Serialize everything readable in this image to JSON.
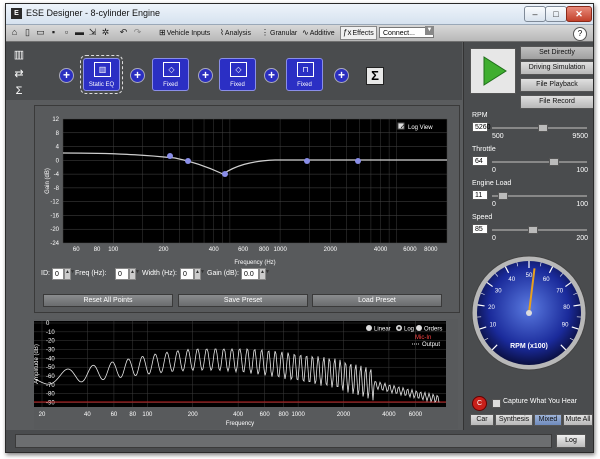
{
  "window": {
    "title": "ESE Designer - 8-cylinder Engine",
    "minimize": "–",
    "maximize": "□",
    "close": "✕"
  },
  "toolbar": {
    "items": [
      {
        "label": "Vehicle Inputs",
        "icon": "vehicle-inputs-icon"
      },
      {
        "label": "Analysis",
        "icon": "analysis-icon"
      },
      {
        "label": "Granular",
        "icon": "granular-icon"
      },
      {
        "label": "Additive",
        "icon": "additive-icon"
      },
      {
        "label": "Effects",
        "icon": "effects-icon",
        "active": true
      }
    ],
    "connect_label": "Connect...",
    "help": "?"
  },
  "chain": {
    "effects": [
      {
        "label": "Static EQ",
        "icon": "equalizer-icon"
      },
      {
        "label": "Fixed",
        "icon": "diamond-filter-icon"
      },
      {
        "label": "Fixed",
        "icon": "diamond-filter-icon"
      },
      {
        "label": "Fixed",
        "icon": "bandpass-filter-icon"
      }
    ],
    "sum_symbol": "Σ",
    "plus_symbol": "+"
  },
  "eq": {
    "log_view_label": "Log View",
    "ylabel": "Gain (dB)",
    "xlabel": "Frequency (Hz)",
    "y_ticks": [
      "12",
      "8",
      "4",
      "0",
      "-4",
      "-8",
      "-12",
      "-16",
      "-20",
      "-24"
    ],
    "x_ticks": [
      "60",
      "80",
      "100",
      "200",
      "400",
      "600",
      "800",
      "1000",
      "2000",
      "4000",
      "6000",
      "8000"
    ],
    "controls": {
      "id_label": "ID:",
      "id_value": "0",
      "freq_label": "Freq (Hz):",
      "freq_value": "0",
      "width_label": "Width (Hz):",
      "width_value": "0",
      "gain_label": "Gain (dB):",
      "gain_value": "0.0"
    },
    "buttons": {
      "reset": "Reset All Points",
      "save": "Save Preset",
      "load": "Load Preset"
    }
  },
  "spectrum": {
    "ylabel": "Amplitude (dB)",
    "xlabel": "Frequency",
    "y_ticks": [
      "0",
      "-10",
      "-20",
      "-30",
      "-40",
      "-50",
      "-60",
      "-70",
      "-80",
      "-90"
    ],
    "x_ticks": [
      "20",
      "40",
      "60",
      "80",
      "100",
      "200",
      "400",
      "600",
      "800",
      "1000",
      "2000",
      "4000",
      "6000"
    ],
    "scale_options": [
      "Linear",
      "Log",
      "Orders"
    ],
    "legend": {
      "mic": "Mic-In",
      "output": "Output"
    }
  },
  "drive": {
    "set_directly": "Set Directly",
    "driving_simulation": "Driving Simulation",
    "file_playback": "File Playback",
    "file_record": "File Record"
  },
  "sliders": [
    {
      "label": "RPM",
      "value": "5260",
      "min": "500",
      "max": "9500",
      "level": 0.53
    },
    {
      "label": "Throttle",
      "value": "64",
      "min": "0",
      "max": "100",
      "level": 0.64
    },
    {
      "label": "Engine Load",
      "value": "11",
      "min": "0",
      "max": "100",
      "level": 0.11
    },
    {
      "label": "Speed",
      "value": "85",
      "min": "0",
      "max": "200",
      "level": 0.425
    }
  ],
  "gauge": {
    "label": "RPM (x100)",
    "value": 52.6,
    "ticks": [
      "10",
      "20",
      "30",
      "40",
      "50",
      "60",
      "70",
      "80",
      "90"
    ]
  },
  "capture": {
    "label": "Capture What You Hear",
    "record_symbol": "C"
  },
  "mode_buttons": [
    "Car",
    "Synthesis",
    "Mixed",
    "Mute All"
  ],
  "status": {
    "log_button": "Log"
  },
  "colors": {
    "chain_blue": "#2b2fc4",
    "play_green": "#3fae2f",
    "gauge_needle": "#e8a020",
    "mic_red": "#c02020"
  }
}
